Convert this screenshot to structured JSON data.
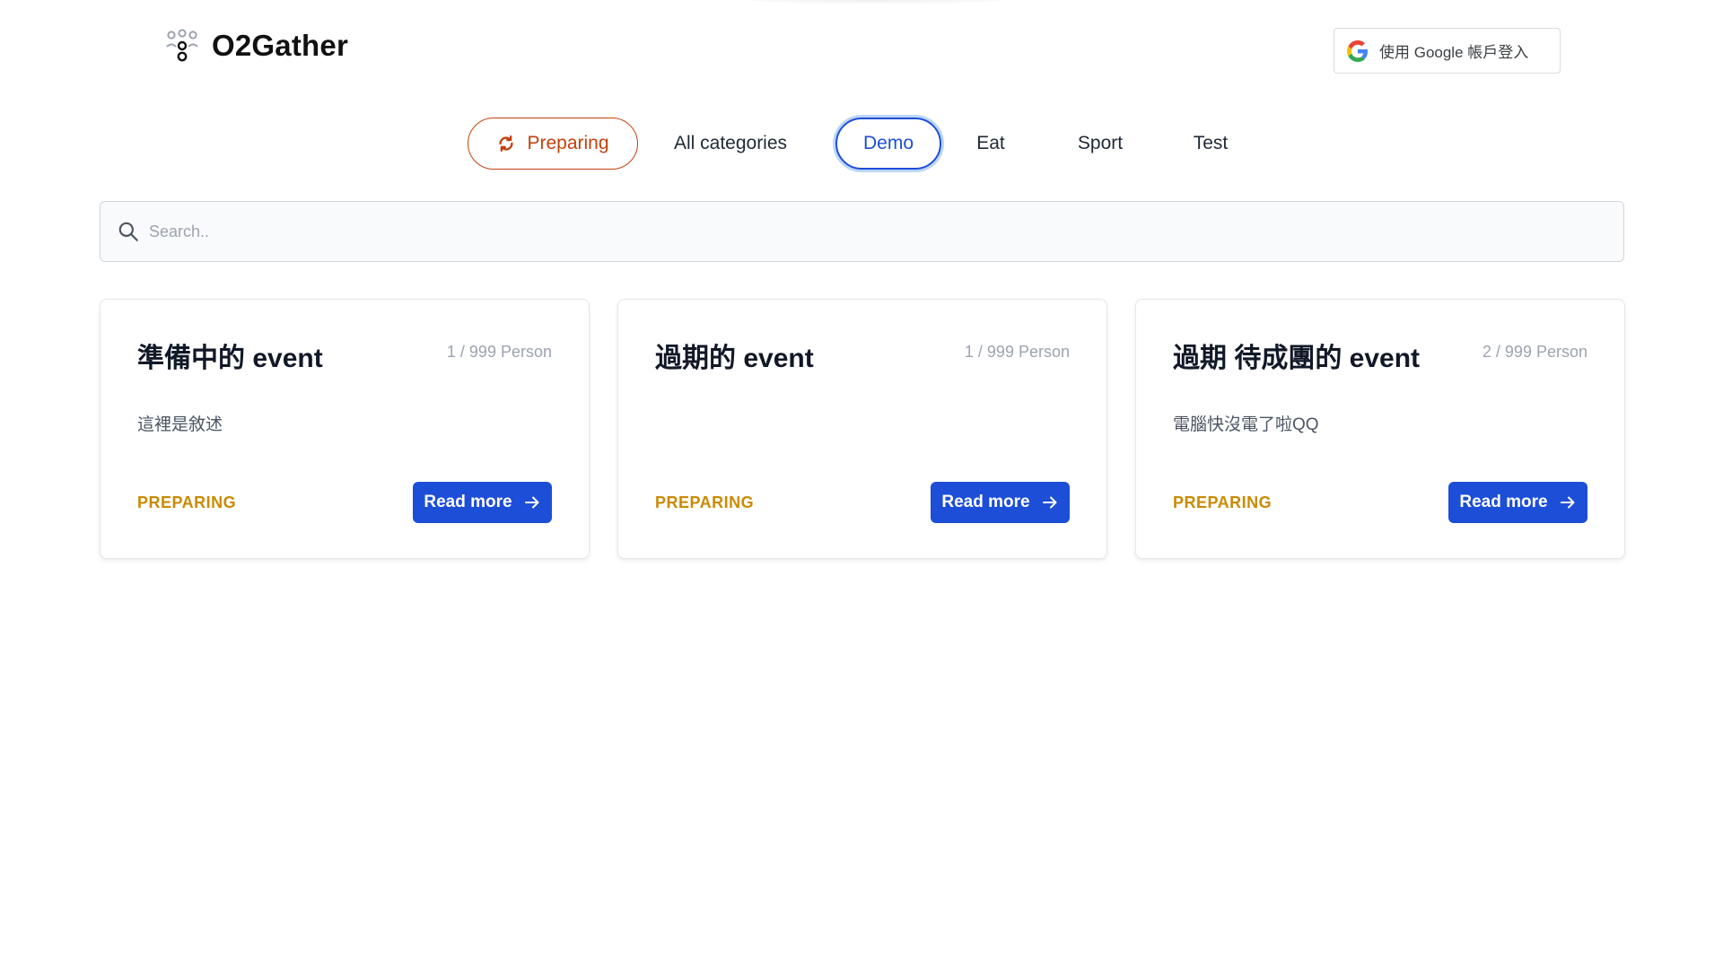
{
  "header": {
    "logo_text": "O2Gather",
    "google_login_label": "使用 Google 帳戶登入"
  },
  "tabs": [
    {
      "label": "Preparing",
      "icon": "refresh-icon",
      "state": "status-filter"
    },
    {
      "label": "All categories"
    },
    {
      "label": "Demo",
      "state": "selected"
    },
    {
      "label": "Eat"
    },
    {
      "label": "Sport"
    },
    {
      "label": "Test"
    }
  ],
  "search": {
    "placeholder": "Search..",
    "value": ""
  },
  "events": [
    {
      "title": "準備中的 event",
      "count": "1 / 999 Person",
      "description": "這裡是敘述",
      "status": "PREPARING",
      "button_label": "Read more"
    },
    {
      "title": "過期的 event",
      "count": "1 / 999 Person",
      "description": "",
      "status": "PREPARING",
      "button_label": "Read more"
    },
    {
      "title": "過期 待成團的 event",
      "count": "2 / 999 Person",
      "description": "電腦快沒電了啦QQ",
      "status": "PREPARING",
      "button_label": "Read more"
    }
  ],
  "colors": {
    "primary": "#1d4ed8",
    "preparing_tab": "#c2410c",
    "status_text": "#ca8a04",
    "focus_ring": "#bcd6fb"
  }
}
